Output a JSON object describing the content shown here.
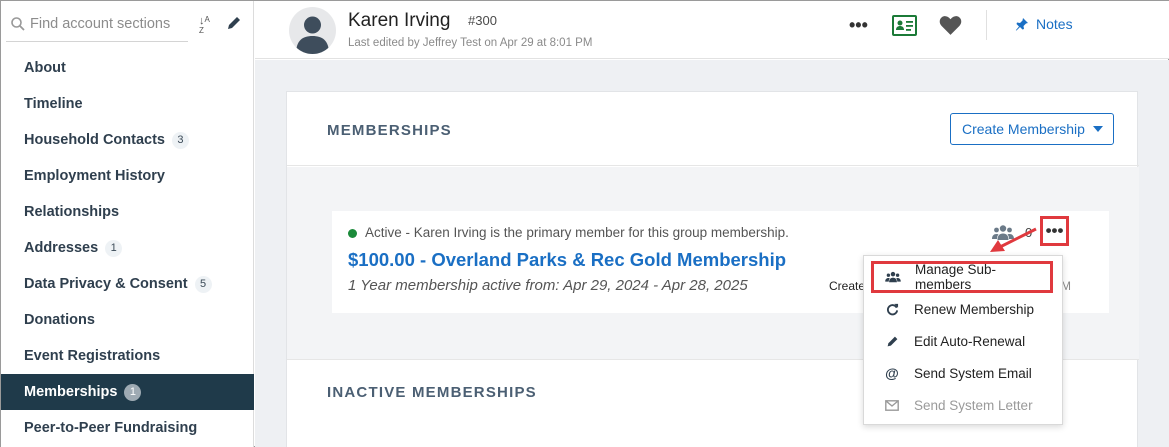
{
  "sidebar": {
    "search_placeholder": "Find account sections",
    "sort_icon": "sort-icon",
    "edit_icon": "pencil-icon",
    "items": [
      {
        "label": "About",
        "badge": ""
      },
      {
        "label": "Timeline",
        "badge": ""
      },
      {
        "label": "Household Contacts",
        "badge": "3"
      },
      {
        "label": "Employment History",
        "badge": ""
      },
      {
        "label": "Relationships",
        "badge": ""
      },
      {
        "label": "Addresses",
        "badge": "1"
      },
      {
        "label": "Data Privacy & Consent",
        "badge": "5"
      },
      {
        "label": "Donations",
        "badge": ""
      },
      {
        "label": "Event Registrations",
        "badge": ""
      },
      {
        "label": "Memberships",
        "badge": "1",
        "active": true
      },
      {
        "label": "Peer-to-Peer Fundraising",
        "badge": ""
      }
    ]
  },
  "header": {
    "name": "Karen Irving",
    "id": "#300",
    "last_edited": "Last edited by Jeffrey Test on Apr 29 at 8:01 PM",
    "more_label": "•••",
    "notes_label": "Notes"
  },
  "memberships": {
    "title": "MEMBERSHIPS",
    "create_button": "Create Membership",
    "inactive_title": "INACTIVE MEMBERSHIPS",
    "item": {
      "status": "Active",
      "status_note": " - Karen Irving is the primary member for this group membership.",
      "title": "$100.00 - Overland Parks & Rec Gold Membership",
      "range": "1 Year membership active from: Apr 29, 2024 - Apr 28, 2025",
      "created_prefix": "Create",
      "created_suffix": "M",
      "sub_count": "0",
      "more_label": "•••"
    }
  },
  "dropdown": {
    "items": [
      {
        "label": "Manage Sub-members",
        "icon": "users-icon"
      },
      {
        "label": "Renew Membership",
        "icon": "refresh-icon"
      },
      {
        "label": "Edit Auto-Renewal",
        "icon": "pencil-icon"
      },
      {
        "label": "Send System Email",
        "icon": "at-icon"
      },
      {
        "label": "Send System Letter",
        "icon": "envelope-icon",
        "disabled": true
      }
    ]
  },
  "colors": {
    "accent": "#1a6fc4",
    "active_nav": "#1f3a4a",
    "status_active": "#1b8a3a",
    "highlight": "#e0393e"
  }
}
